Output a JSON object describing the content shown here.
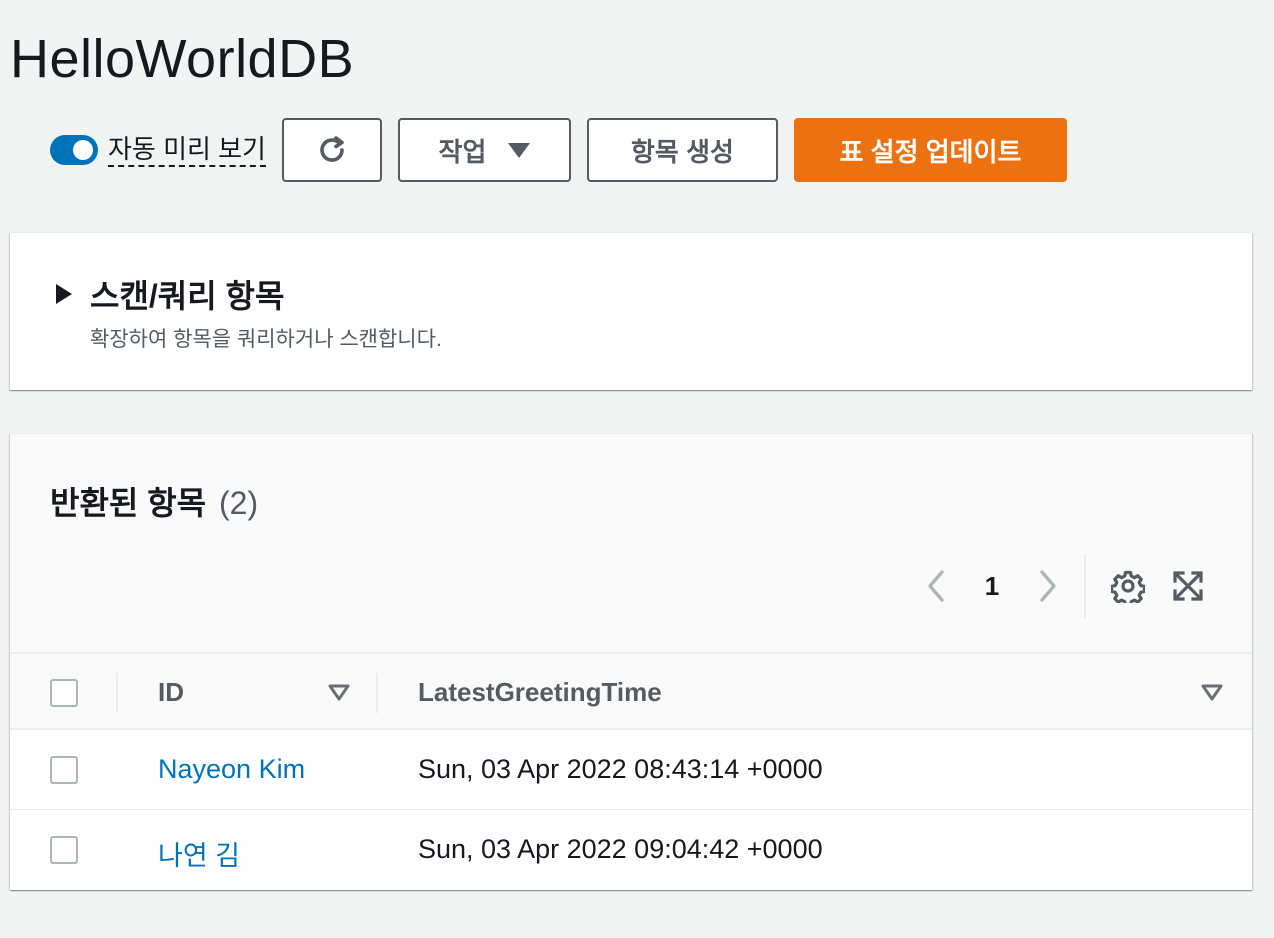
{
  "page": {
    "title": "HelloWorldDB"
  },
  "toolbar": {
    "auto_preview_label": "자동 미리 보기",
    "auto_preview_on": true,
    "refresh_icon": "refresh-icon",
    "actions_label": "작업",
    "create_item_label": "항목 생성",
    "update_table_label": "표 설정 업데이트",
    "primary_color": "#ec7211",
    "toggle_color": "#0073bb"
  },
  "scan": {
    "title": "스캔/쿼리 항목",
    "description": "확장하여 항목을 쿼리하거나 스캔합니다.",
    "expanded": false
  },
  "items": {
    "title": "반환된 항목",
    "count": "(2)",
    "pagination": {
      "current_page": "1",
      "prev_icon": "chevron-left-icon",
      "next_icon": "chevron-right-icon"
    },
    "settings_icon": "gear-icon",
    "fullscreen_icon": "fullscreen-icon",
    "columns": [
      {
        "label": "ID",
        "sortable": true
      },
      {
        "label": "LatestGreetingTime",
        "sortable": true
      }
    ],
    "rows": [
      {
        "id": "Nayeon Kim",
        "latest_greeting_time": "Sun, 03 Apr 2022 08:43:14 +0000"
      },
      {
        "id": "나연 김",
        "latest_greeting_time": "Sun, 03 Apr 2022 09:04:42 +0000"
      }
    ],
    "link_color": "#0073bb"
  }
}
